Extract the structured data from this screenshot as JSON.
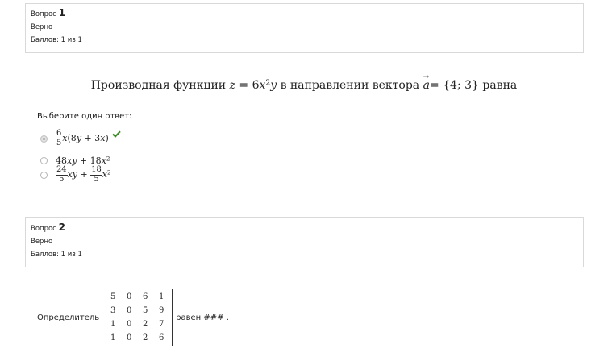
{
  "q1": {
    "info": {
      "label": "Вопрос",
      "number": "1",
      "state": "Верно",
      "grade": "Баллов: 1 из 1"
    },
    "text": {
      "before": "Производная функции ",
      "middle": " в направлении вектора ",
      "after": " равна"
    },
    "prompt": "Выберите один ответ:",
    "selected_option": 0,
    "correct_icon": "check-icon",
    "correct_color": "#3a8b24"
  },
  "q2": {
    "info": {
      "label": "Вопрос",
      "number": "2",
      "state": "Верно",
      "grade": "Баллов: 1 из 1"
    },
    "before": "Определитель",
    "matrix": [
      [
        "5",
        "0",
        "6",
        "1"
      ],
      [
        "3",
        "0",
        "5",
        "9"
      ],
      [
        "1",
        "0",
        "2",
        "7"
      ],
      [
        "1",
        "0",
        "2",
        "6"
      ]
    ],
    "after": "равен ### ."
  }
}
